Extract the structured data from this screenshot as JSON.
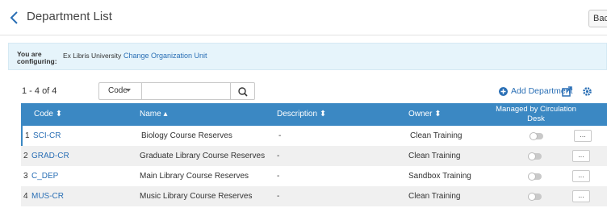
{
  "header": {
    "title": "Department List",
    "back_label": "Back"
  },
  "config": {
    "label": "You are configuring:",
    "org_name": "Ex Libris University",
    "change_link": "Change Organization Unit"
  },
  "toolbar": {
    "results": "1 - 4 of 4",
    "search_field": "Code",
    "search_value": "",
    "add_label": "Add Department"
  },
  "columns": {
    "code": "Code",
    "name": "Name",
    "description": "Description",
    "owner": "Owner",
    "managed": "Managed by Circulation Desk"
  },
  "rows": [
    {
      "num": "1",
      "code": "SCI-CR",
      "name": "Biology Course Reserves",
      "description": "-",
      "owner": "Clean Training",
      "managed": false,
      "more": "..."
    },
    {
      "num": "2",
      "code": "GRAD-CR",
      "name": "Graduate Library Course Reserves",
      "description": "-",
      "owner": "Clean Training",
      "managed": false,
      "more": "..."
    },
    {
      "num": "3",
      "code": "C_DEP",
      "name": "Main Library Course Reserves",
      "description": "-",
      "owner": "Sandbox Training",
      "managed": false,
      "more": "..."
    },
    {
      "num": "4",
      "code": "MUS-CR",
      "name": "Music Library Course Reserves",
      "description": "-",
      "owner": "Clean Training",
      "managed": false,
      "more": "..."
    }
  ],
  "colors": {
    "accent": "#3b88c3",
    "link": "#2a6fb5",
    "config_bg": "#e6f4fb"
  }
}
